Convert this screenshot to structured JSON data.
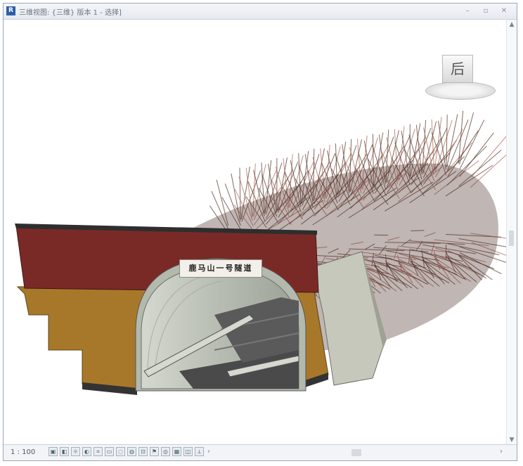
{
  "window": {
    "title": "三维视图: {三维} 版本 1 - 选择]",
    "minimize_label": "–",
    "restore_label": "▫",
    "close_label": "✕"
  },
  "viewcube": {
    "face_label": "后"
  },
  "model": {
    "portal_sign": "鹿马山一号隧道"
  },
  "statusbar": {
    "scale": "1 : 100",
    "left_arrow": "‹",
    "right_arrow": "›",
    "tool_icons": [
      "model-graphics-icon",
      "visual-style-icon",
      "sun-path-icon",
      "shadows-icon",
      "crop-view-icon",
      "show-crop-icon",
      "temporary-hide-icon",
      "reveal-hidden-icon",
      "lock-view-icon",
      "analysis-icon",
      "highlight-icon",
      "worksharing-icon",
      "design-options-icon",
      "constraints-icon"
    ]
  },
  "colors": {
    "portal_top": "#7a2a26",
    "portal_lower": "#a8782a",
    "lining": "#c9cfc4",
    "rock_bolts": "#5a3a2c"
  }
}
